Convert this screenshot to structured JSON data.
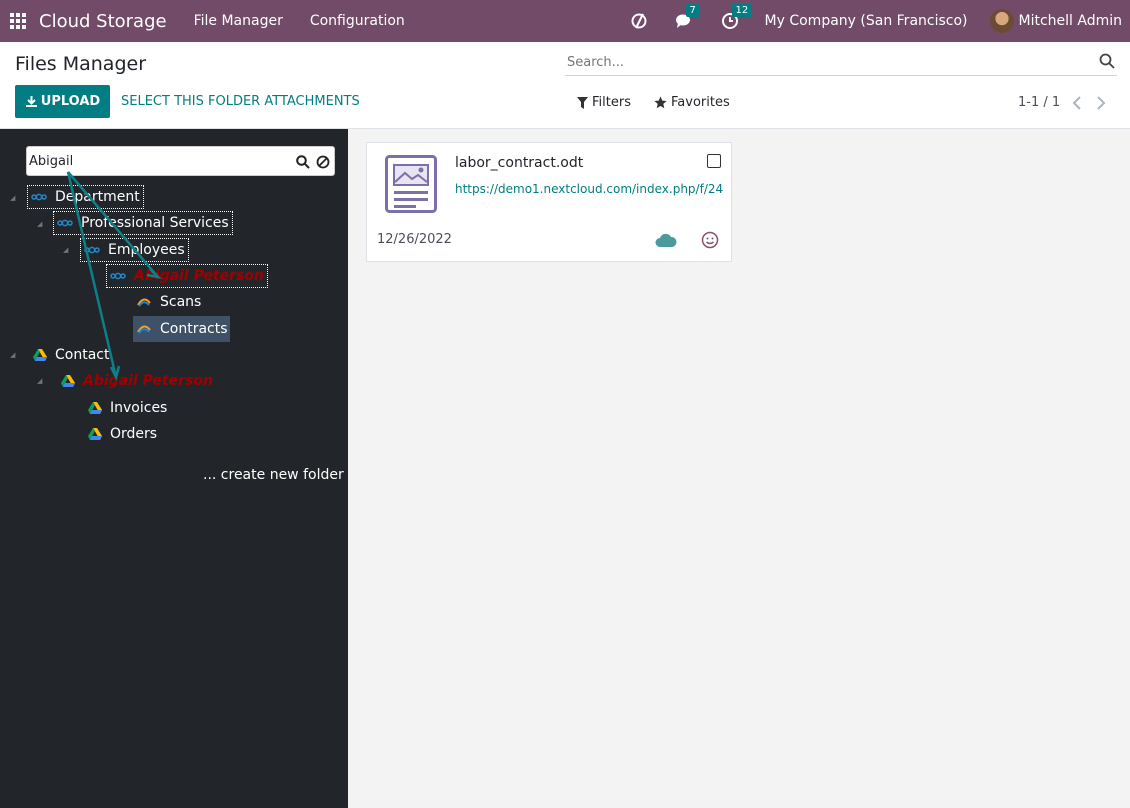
{
  "navbar": {
    "app_name": "Cloud Storage",
    "menu": [
      "File Manager",
      "Configuration"
    ],
    "messages_count": "7",
    "activities_count": "12",
    "company": "My Company (San Francisco)",
    "user": "Mitchell Admin",
    "bg_color": "#714B67"
  },
  "control_panel": {
    "title": "Files Manager",
    "search_placeholder": "Search...",
    "upload_label": "UPLOAD",
    "select_folder_label": "SELECT THIS FOLDER ATTACHMENTS",
    "filters_label": "Filters",
    "favorites_label": "Favorites",
    "pager": "1-1 / 1",
    "accent_color": "#017e84"
  },
  "sidebar": {
    "search_value": "Abigail",
    "tree": [
      {
        "label": "Department"
      },
      {
        "label": "Professional Services"
      },
      {
        "label": "Employees"
      },
      {
        "label": "Abigail Peterson",
        "highlighted": true
      },
      {
        "label": "Scans"
      },
      {
        "label": "Contracts",
        "selected": true
      },
      {
        "label": "Contact"
      },
      {
        "label": "Abigail Peterson",
        "highlighted": true
      },
      {
        "label": "Invoices"
      },
      {
        "label": "Orders"
      }
    ],
    "create_folder": "... create new folder"
  },
  "attachments": [
    {
      "name": "labor_contract.odt",
      "url": "https://demo1.nextcloud.com/index.php/f/240",
      "date": "12/26/2022"
    }
  ]
}
